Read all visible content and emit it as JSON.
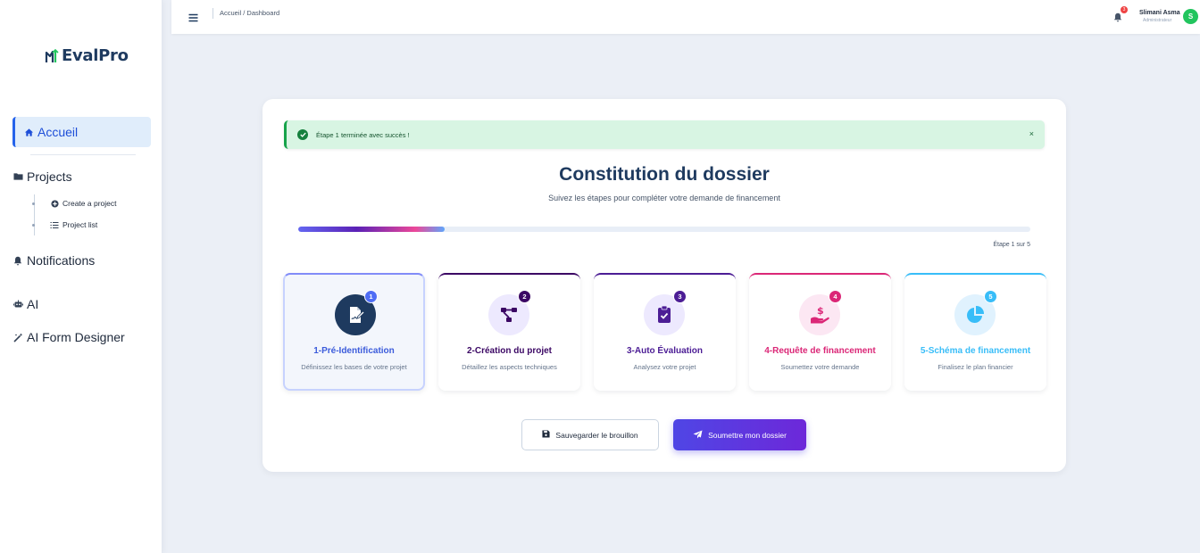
{
  "app": {
    "name": "EvalPro"
  },
  "sidebar": {
    "items": [
      {
        "label": "Accueil",
        "icon": "home-icon",
        "active": true
      },
      {
        "label": "Projects",
        "icon": "folder-icon"
      },
      {
        "label": "Notifications",
        "icon": "bell-icon"
      },
      {
        "label": "AI",
        "icon": "robot-icon"
      },
      {
        "label": "AI Form Designer",
        "icon": "magic-wand-icon"
      }
    ],
    "projects_sub": [
      {
        "label": "Create a project",
        "icon": "plus-circle-icon"
      },
      {
        "label": "Project list",
        "icon": "list-icon"
      }
    ]
  },
  "topbar": {
    "breadcrumb": "Accueil / Dashboard",
    "notifications_count": "3",
    "user_name": "Slimani Asma",
    "user_role": "Administrateur",
    "avatar_initial": "S"
  },
  "alert": {
    "message": "Étape 1 terminée avec succès !",
    "close": "×"
  },
  "main": {
    "title": "Constitution du dossier",
    "subtitle": "Suivez les étapes pour compléter votre demande de financement",
    "progress_percent": 20,
    "step_counter": "Étape 1 sur 5"
  },
  "steps": [
    {
      "number": "1",
      "title": "1-Pré-Identification",
      "desc": "Définissez les bases de votre projet",
      "color": "#3b5bdb",
      "icon": "document-sign-icon"
    },
    {
      "number": "2",
      "title": "2-Création du projet",
      "desc": "Détaillez les aspects techniques",
      "color": "#3b0764",
      "icon": "project-diagram-icon"
    },
    {
      "number": "3",
      "title": "3-Auto Évaluation",
      "desc": "Analysez votre projet",
      "color": "#4c1d95",
      "icon": "clipboard-check-icon"
    },
    {
      "number": "4",
      "title": "4-Requête de financement",
      "desc": "Soumettez votre demande",
      "color": "#db2777",
      "icon": "hand-dollar-icon"
    },
    {
      "number": "5",
      "title": "5-Schéma de financement",
      "desc": "Finalisez le plan financier",
      "color": "#38bdf8",
      "icon": "pie-chart-icon"
    }
  ],
  "actions": {
    "save_draft": "Sauvegarder le brouillon",
    "submit": "Soumettre mon dossier"
  }
}
